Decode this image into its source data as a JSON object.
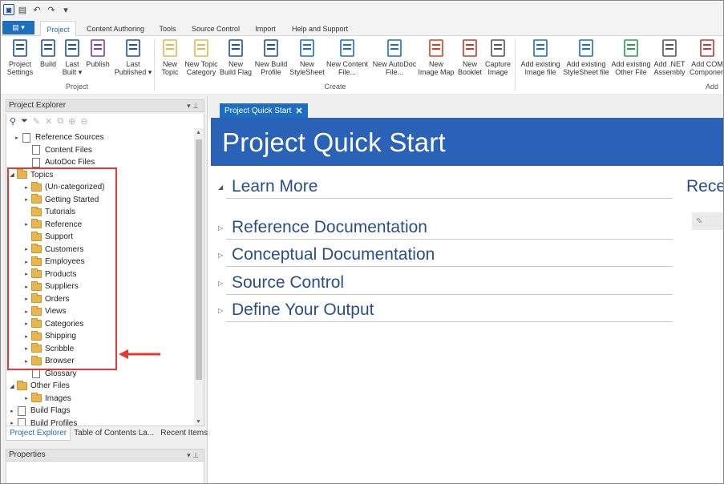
{
  "ribbon_tabs": {
    "file_icon": "app-menu-icon",
    "tabs": [
      "Project",
      "Content Authoring",
      "Tools",
      "Source Control",
      "Import",
      "Help and Support"
    ]
  },
  "ribbon": {
    "buttons": [
      {
        "label": "Project\nSettings",
        "icon": "project-settings-icon"
      },
      {
        "label": "Build",
        "icon": "build-icon"
      },
      {
        "label": "Last\nBuilt ▾",
        "icon": "last-built-icon"
      },
      {
        "label": "Publish",
        "icon": "publish-icon"
      },
      {
        "label": "Last\nPublished ▾",
        "icon": "last-published-icon"
      },
      {
        "label": "New\nTopic",
        "icon": "new-topic-icon"
      },
      {
        "label": "New Topic\nCategory",
        "icon": "new-topic-category-icon"
      },
      {
        "label": "New\nBuild Flag",
        "icon": "new-build-flag-icon"
      },
      {
        "label": "New Build\nProfile",
        "icon": "new-build-profile-icon"
      },
      {
        "label": "New\nStyleSheet",
        "icon": "new-stylesheet-icon"
      },
      {
        "label": "New Content\nFile...",
        "icon": "new-content-file-icon"
      },
      {
        "label": "New AutoDoc\nFile...",
        "icon": "new-autodoc-file-icon"
      },
      {
        "label": "New\nImage Map",
        "icon": "new-image-map-icon"
      },
      {
        "label": "New\nBooklet",
        "icon": "new-booklet-icon"
      },
      {
        "label": "Capture\nImage",
        "icon": "capture-image-icon"
      },
      {
        "label": "Add existing\nImage file",
        "icon": "add-image-file-icon"
      },
      {
        "label": "Add existing\nStyleSheet file",
        "icon": "add-stylesheet-file-icon"
      },
      {
        "label": "Add existing\nOther File",
        "icon": "add-other-file-icon"
      },
      {
        "label": "Add .NET\nAssembly",
        "icon": "add-net-assembly-icon"
      },
      {
        "label": "Add COM\nComponen",
        "icon": "add-com-component-icon"
      }
    ],
    "groups": [
      "Project",
      "Create",
      "Add"
    ]
  },
  "project_explorer": {
    "title": "Project Explorer",
    "tree": [
      {
        "label": "Reference Sources",
        "arrow": "▸",
        "icon": "reference-sources-icon"
      },
      {
        "label": "Content Files",
        "arrow": "",
        "icon": "content-files-icon"
      },
      {
        "label": "AutoDoc Files",
        "arrow": "",
        "icon": "autodoc-files-icon"
      },
      {
        "label": "Topics",
        "arrow": "◢",
        "icon": "folder-icon"
      },
      {
        "label": "(Un-categorized)",
        "arrow": "▸",
        "icon": "folder-icon"
      },
      {
        "label": "Getting Started",
        "arrow": "▸",
        "icon": "folder-icon"
      },
      {
        "label": "Tutorials",
        "arrow": "",
        "icon": "folder-icon"
      },
      {
        "label": "Reference",
        "arrow": "▸",
        "icon": "folder-icon"
      },
      {
        "label": "Support",
        "arrow": "",
        "icon": "folder-icon"
      },
      {
        "label": "Customers",
        "arrow": "▸",
        "icon": "folder-icon"
      },
      {
        "label": "Employees",
        "arrow": "▸",
        "icon": "folder-icon"
      },
      {
        "label": "Products",
        "arrow": "▸",
        "icon": "folder-icon"
      },
      {
        "label": "Suppliers",
        "arrow": "▸",
        "icon": "folder-icon"
      },
      {
        "label": "Orders",
        "arrow": "▸",
        "icon": "folder-icon"
      },
      {
        "label": "Views",
        "arrow": "▸",
        "icon": "folder-icon"
      },
      {
        "label": "Categories",
        "arrow": "▸",
        "icon": "folder-icon"
      },
      {
        "label": "Shipping",
        "arrow": "▸",
        "icon": "folder-icon"
      },
      {
        "label": "Scribble",
        "arrow": "▸",
        "icon": "folder-icon"
      },
      {
        "label": "Browser",
        "arrow": "▸",
        "icon": "folder-icon"
      },
      {
        "label": "Glossary",
        "arrow": "",
        "icon": "glossary-icon"
      },
      {
        "label": "Other Files",
        "arrow": "◢",
        "icon": "folder-icon"
      },
      {
        "label": "Images",
        "arrow": "▸",
        "icon": "folder-icon"
      },
      {
        "label": "Build Flags",
        "arrow": "▸",
        "icon": "build-flags-icon"
      },
      {
        "label": "Build Profiles",
        "arrow": "▸",
        "icon": "build-profiles-icon"
      }
    ],
    "bottom_tabs": [
      "Project Explorer",
      "Table of Contents La...",
      "Recent Items"
    ]
  },
  "properties": {
    "title": "Properties"
  },
  "document": {
    "tab_label": "Project Quick Start",
    "banner_title": "Project Quick Start",
    "sections": [
      "Learn More",
      "Reference Documentation",
      "Conceptual Documentation",
      "Source Control",
      "Define Your Output"
    ],
    "right_heading": "Rece"
  },
  "colors": {
    "accent": "#1e6ec0",
    "banner": "#2a62b8",
    "heading": "#2a4e8c",
    "highlight": "#e53935"
  }
}
